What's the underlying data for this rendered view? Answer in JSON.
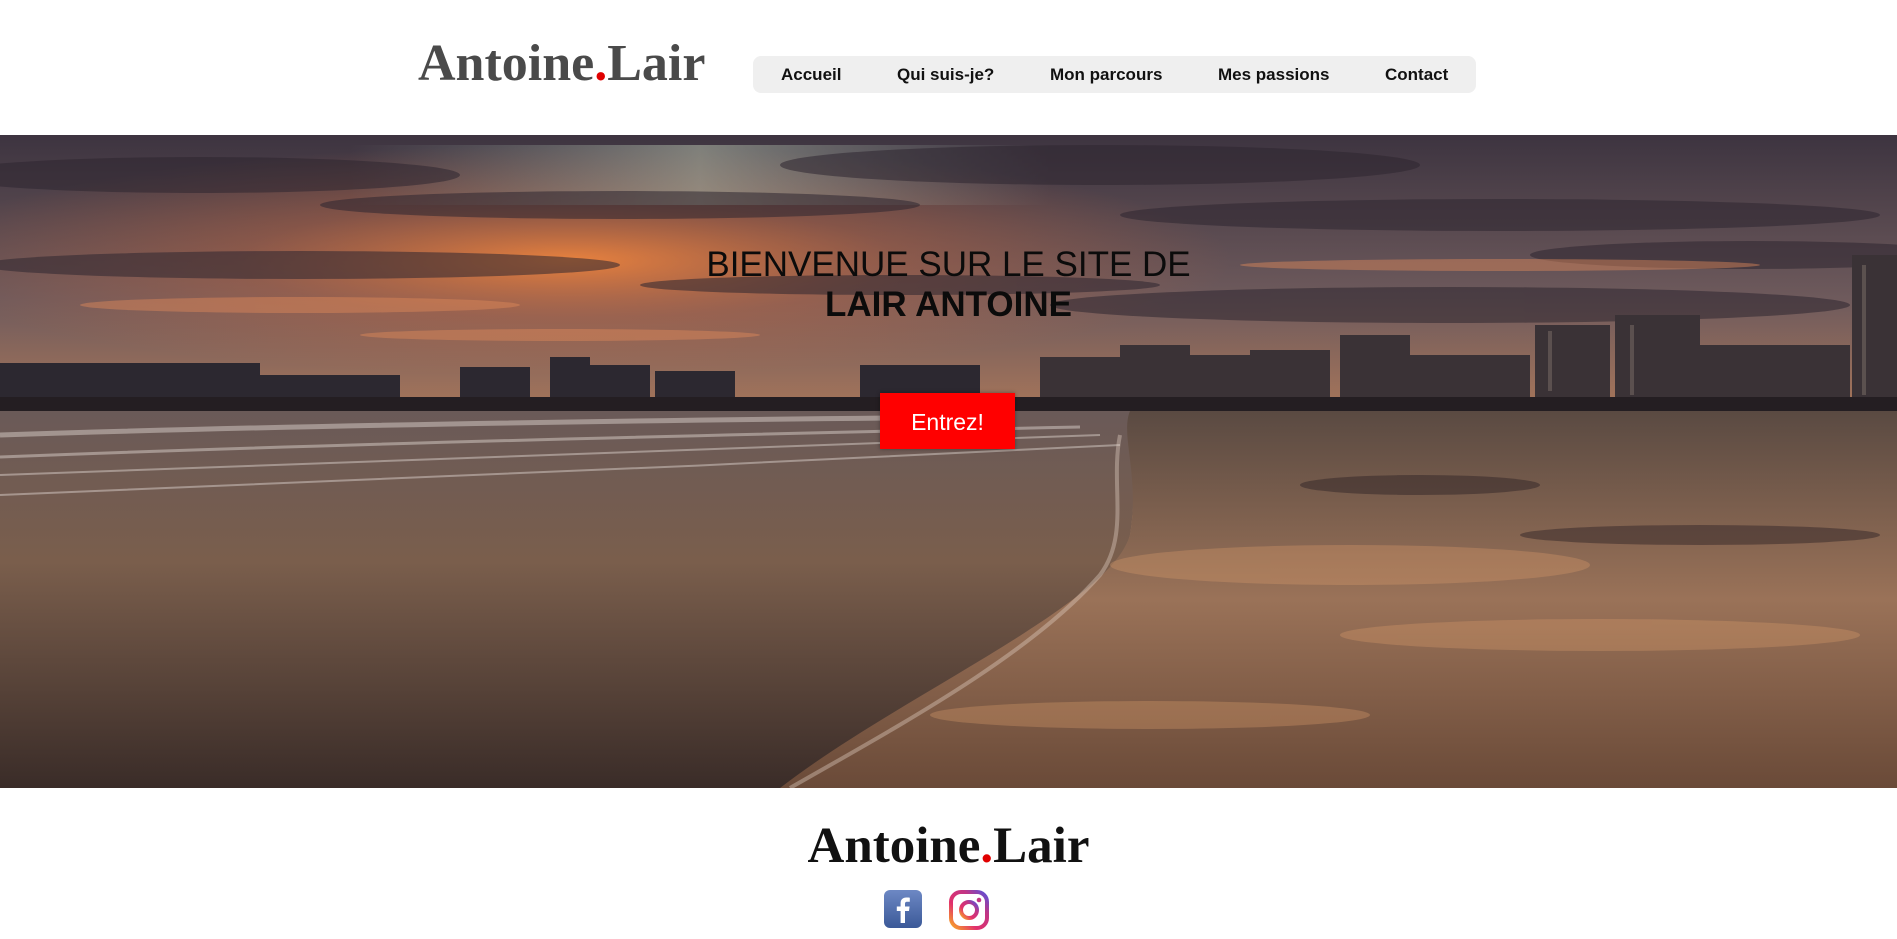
{
  "header": {
    "logo_first": "Antoine",
    "logo_dot": ".",
    "logo_last": "Lair",
    "nav": [
      {
        "label": "Accueil"
      },
      {
        "label": "Qui suis-je?"
      },
      {
        "label": "Mon parcours"
      },
      {
        "label": "Mes passions"
      },
      {
        "label": "Contact"
      }
    ]
  },
  "hero": {
    "title_line1": "BIENVENUE SUR LE SITE DE",
    "title_line2": "LAIR ANTOINE",
    "button_label": "Entrez!",
    "background": "beach-sunset-photo"
  },
  "footer": {
    "logo_first": "Antoine",
    "logo_dot": ".",
    "logo_last": "Lair",
    "social": [
      {
        "icon": "facebook-icon"
      },
      {
        "icon": "instagram-icon"
      }
    ]
  },
  "colors": {
    "accent": "#ff0000",
    "nav_bg": "#efefef",
    "logo_dot": "#e00000"
  }
}
